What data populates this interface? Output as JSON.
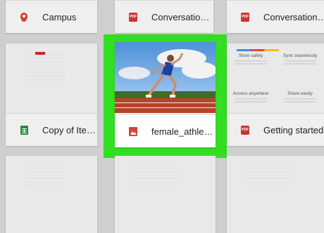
{
  "cards": {
    "campus": {
      "name": "Campus",
      "icon": "map-pin-icon"
    },
    "conv1": {
      "name": "Conversation b…",
      "icon": "pdf-icon"
    },
    "conv2": {
      "name": "Conversation b…",
      "icon": "pdf-icon"
    },
    "copy_items": {
      "name": "Copy of Items",
      "icon": "sheets-icon"
    },
    "female": {
      "name": "female_athlete…",
      "icon": "image-icon"
    },
    "getting_started": {
      "name": "Getting started",
      "icon": "pdf-icon",
      "features": [
        {
          "title": "Store safely"
        },
        {
          "title": "Sync seamlessly"
        },
        {
          "title": "Access anywhere"
        },
        {
          "title": "Share easily"
        }
      ]
    }
  },
  "icons": {
    "pdf_label": "PDF"
  },
  "colors": {
    "highlight": "#33dd22",
    "pdf": "#c8372d",
    "sheets": "#1e8e3e",
    "image": "#d9413a"
  }
}
